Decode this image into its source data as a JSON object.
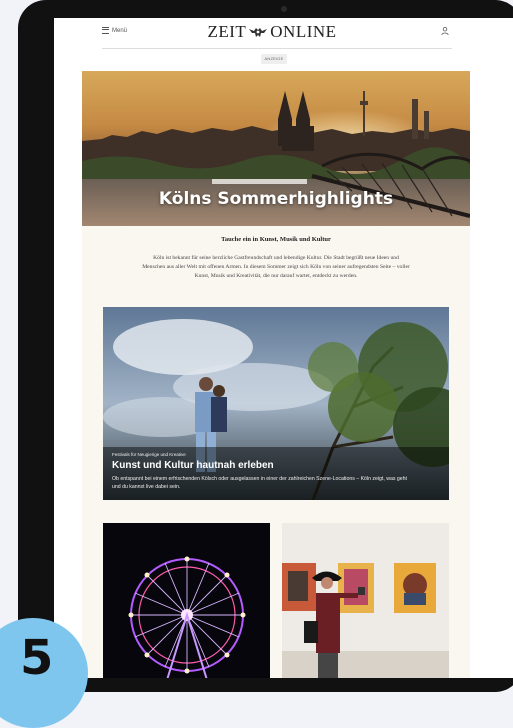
{
  "header": {
    "menu_label": "Menü",
    "logo_left": "ZEIT",
    "logo_right": "ONLINE"
  },
  "ad_label": "ANZEIGE",
  "hero": {
    "title": "Kölns Sommerhighlights"
  },
  "intro": {
    "heading": "Tauche ein in Kunst, Musik und Kultur",
    "text": "Köln ist bekannt für seine herzliche Gastfreundschaft und lebendige Kultur. Die Stadt begrüßt neue Ideen und Menschen aus aller Welt mit offenen Armen. In diesem Sommer zeigt sich Köln von seiner aufregendsten Seite – voller Kunst, Musik und Kreativität, die nur darauf wartet, entdeckt zu werden."
  },
  "feature": {
    "kicker": "Festivals für Neugierige und Kreative",
    "title": "Kunst und Kultur hautnah erleben",
    "text": "Ob entspannt bei einem erfrischenden Kölsch oder ausgelassen in einer der zahlreichen Szene-Locations – Köln zeigt, was geht und du kannst live dabei sein."
  },
  "badge": "5",
  "icons": [
    "menu-icon",
    "user-icon",
    "camera-icon"
  ]
}
